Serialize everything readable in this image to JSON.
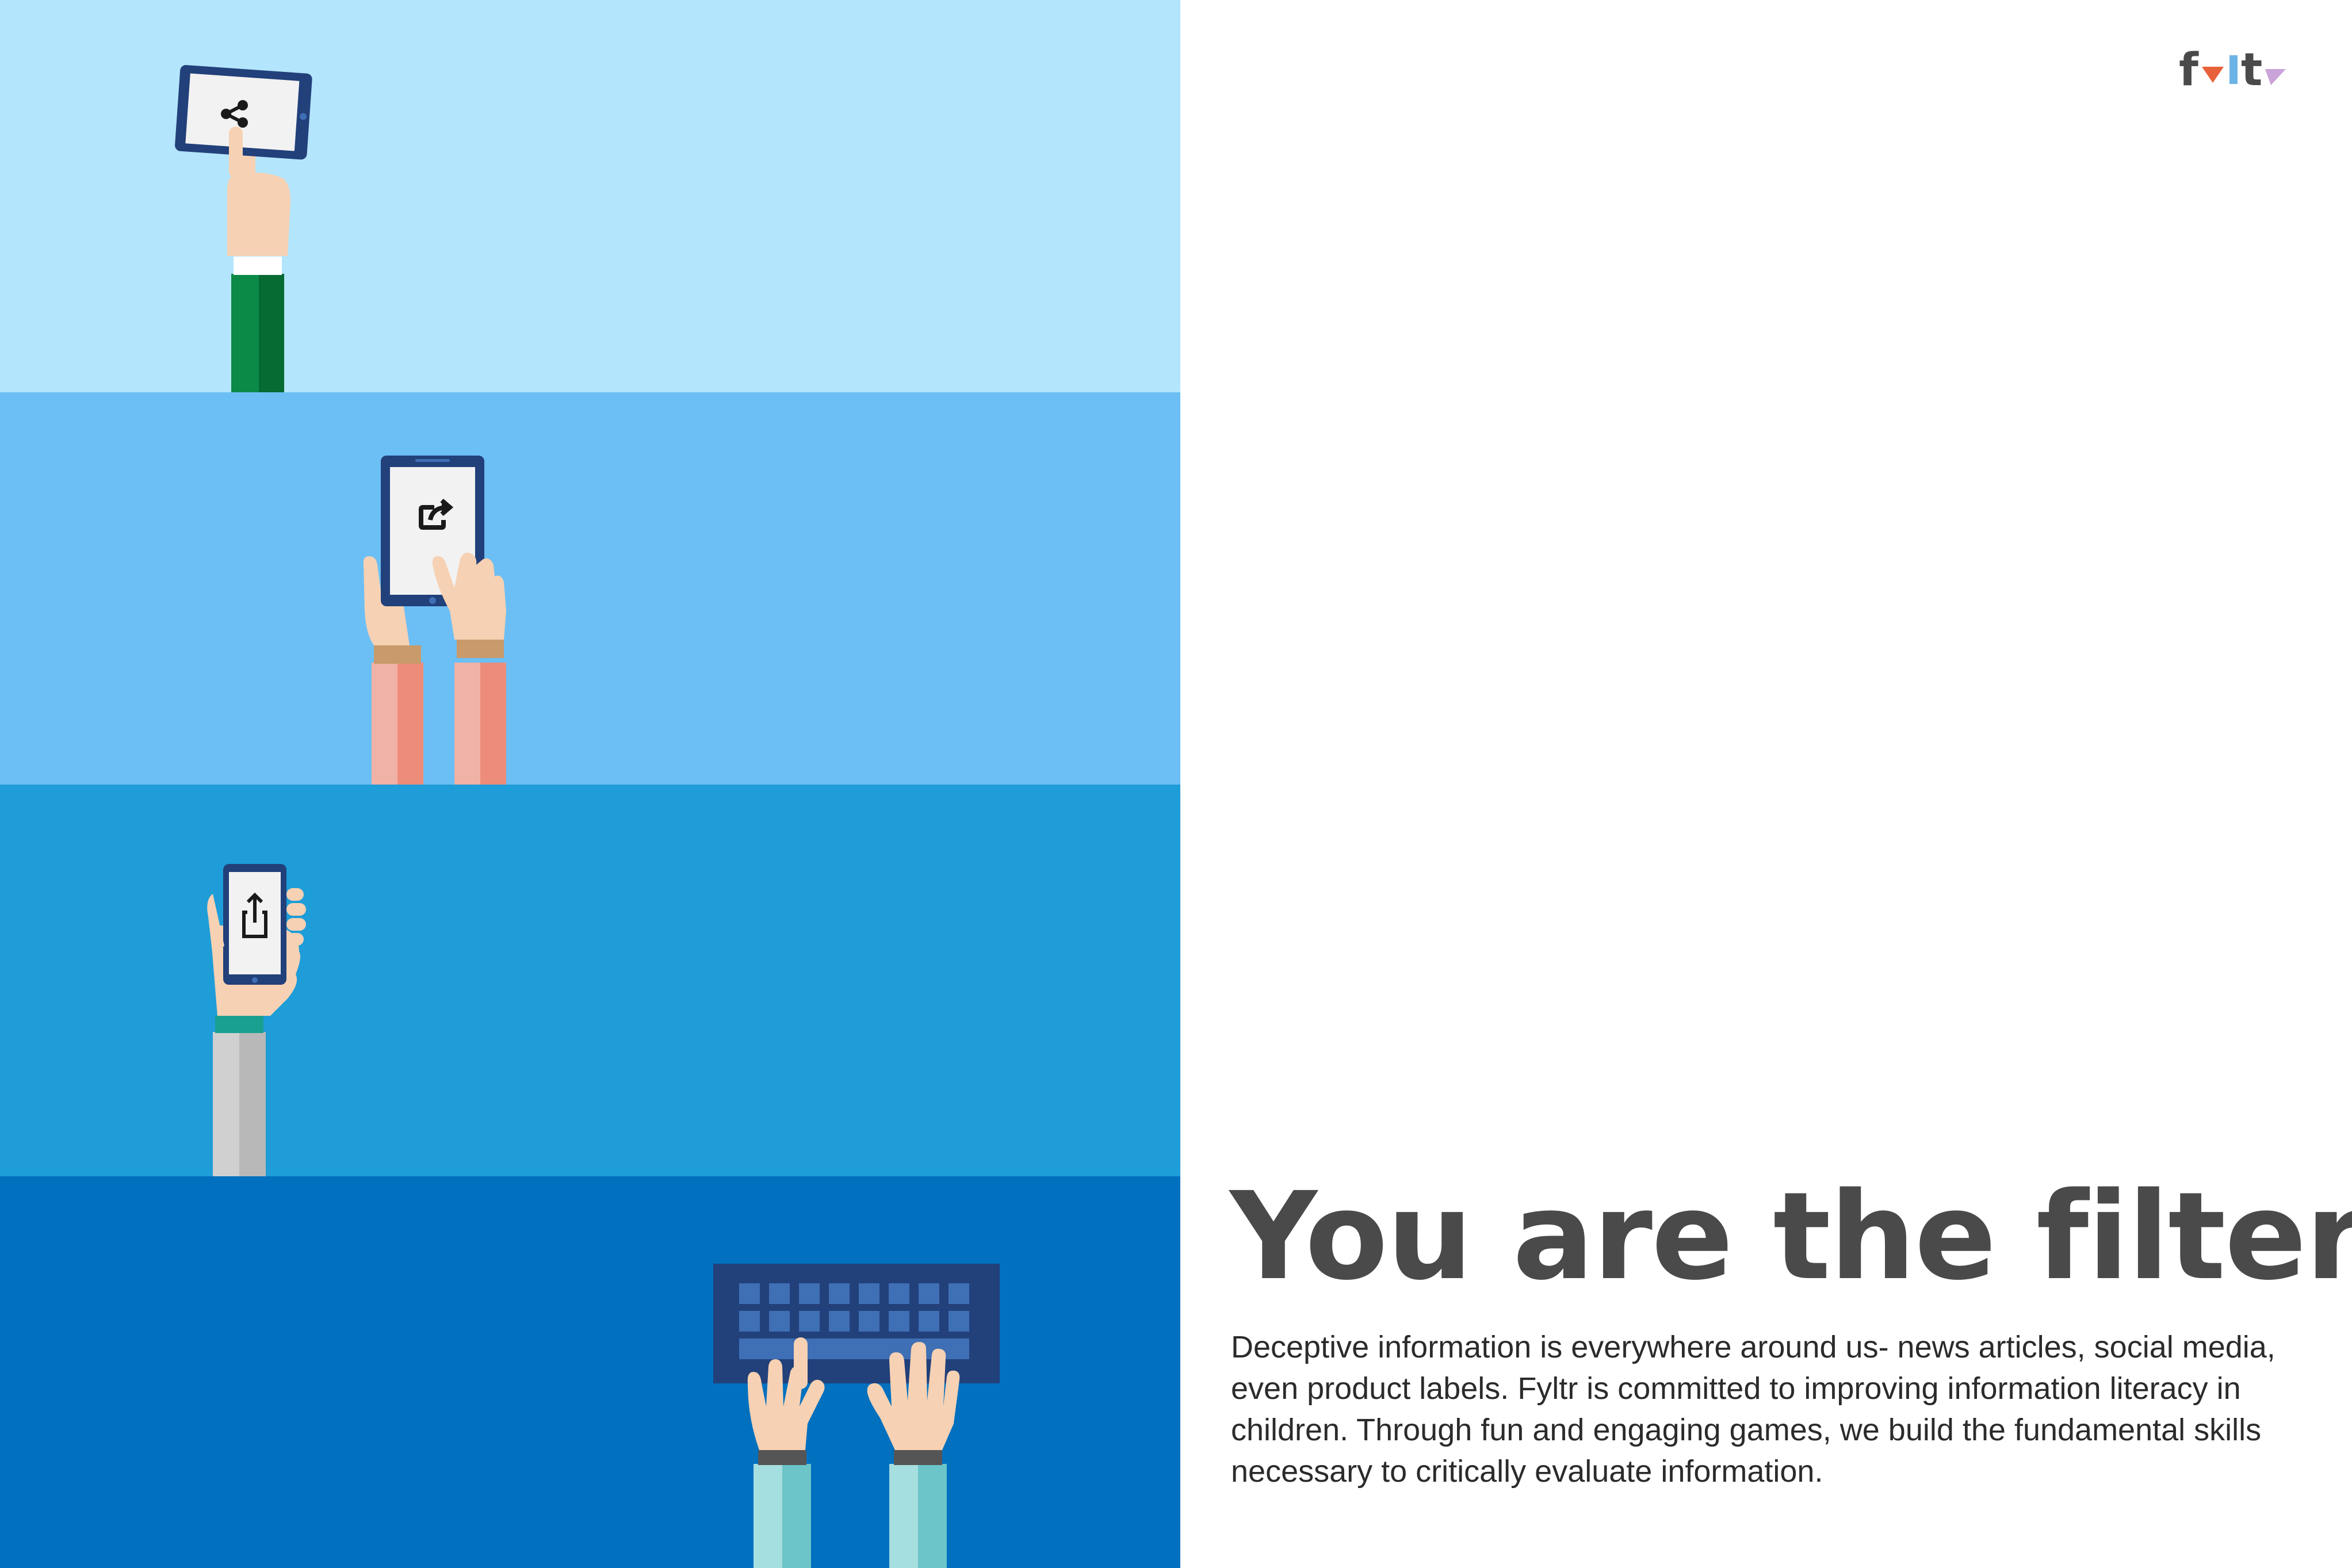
{
  "logo": {
    "text": "fyltr"
  },
  "headline": "You are the filter",
  "body": "Deceptive information is everywhere around us- news articles, social media, even product labels. Fyltr is committed to improving information literacy in children. Through fun and engaging games, we build the fundamental skills necessary to critically evaluate information.",
  "colors": {
    "band1": "#b3e5fc",
    "band2": "#6cbff4",
    "band3": "#1e9dd8",
    "band4": "#0070bf",
    "headline": "#4a4a4a",
    "device": "#22407a",
    "screen": "#f2f2f2",
    "skin": "#f6d1b3"
  },
  "illustrations": [
    {
      "name": "hand-tapping-tablet",
      "icon": "share-icon"
    },
    {
      "name": "hands-holding-tablet",
      "icon": "forward-icon"
    },
    {
      "name": "hand-holding-phone",
      "icon": "upload-icon"
    },
    {
      "name": "hands-typing-keyboard",
      "icon": "keyboard-icon"
    }
  ]
}
